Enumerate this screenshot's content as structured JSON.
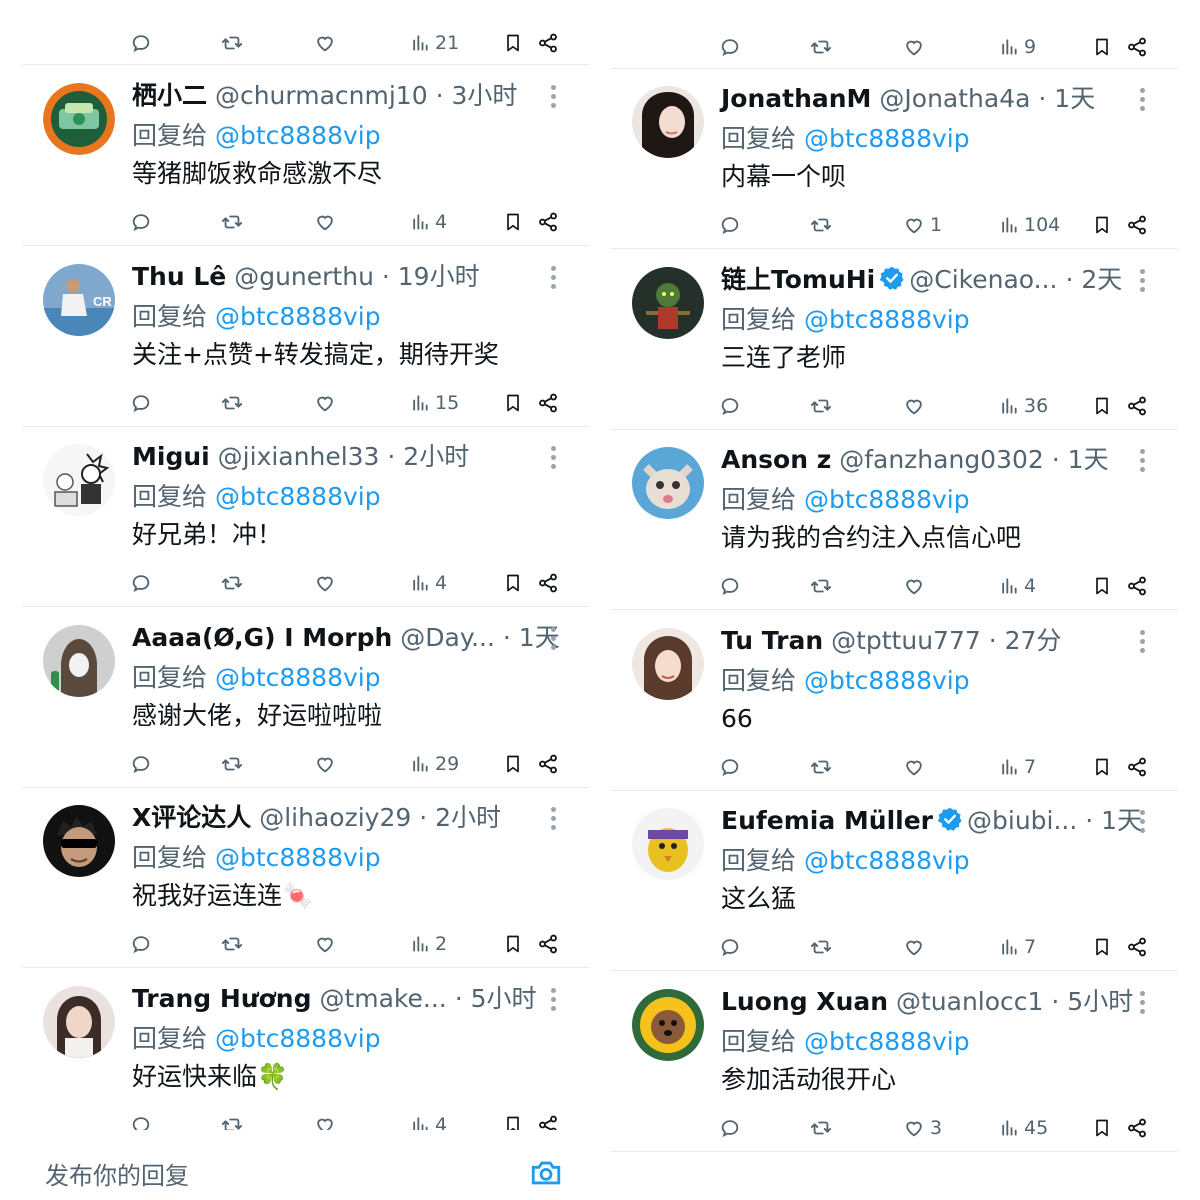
{
  "reply_prefix": "回复给 ",
  "mention": "@btc8888vip",
  "left": {
    "partial_top_views": "21",
    "tweets": [
      {
        "name": "栖小二",
        "handle": "@churmacnmj10",
        "time": "· 3小时",
        "text": "等猪脚饭救命感激不尽",
        "likes": "",
        "views": "4",
        "avatar": "green-badge"
      },
      {
        "name": "Thu Lê",
        "handle": "@gunerthu",
        "time": "· 19小时",
        "text": "关注+点赞+转发搞定，期待开奖",
        "likes": "",
        "views": "15",
        "avatar": "soccer-player"
      },
      {
        "name": "Migui",
        "handle": "@jixianhel33",
        "time": "· 2小时",
        "text": "好兄弟！冲！",
        "likes": "",
        "views": "4",
        "avatar": "manga-sketch"
      },
      {
        "name": "Aaaa(Ø,G) I Morph",
        "handle": "@Day...",
        "time": "· 1天",
        "text": "感谢大佬，好运啦啦啦",
        "likes": "",
        "views": "29",
        "avatar": "hooded-figure"
      },
      {
        "name": "X评论达人",
        "handle": "@lihaoziy29",
        "time": "· 2小时",
        "text": "祝我好运连连🍬",
        "likes": "",
        "views": "2",
        "avatar": "sunglasses-cartoon"
      },
      {
        "name": "Trang Hương",
        "handle": "@tmake...",
        "time": "· 5小时",
        "text": "好运快来临🍀",
        "likes": "",
        "views": "4",
        "avatar": "girl-photo"
      }
    ],
    "compose_placeholder": "发布你的回复"
  },
  "right": {
    "partial_top_views": "9",
    "tweets": [
      {
        "name": "JonathanM",
        "handle": "@Jonatha4a",
        "time": "· 1天",
        "text": "内幕一个呗",
        "likes": "1",
        "views": "104",
        "avatar": "woman-portrait",
        "verified": false
      },
      {
        "name": "链上TomuHi",
        "handle": "@Cikenao...",
        "time": "· 2天",
        "text": "三连了老师",
        "likes": "",
        "views": "36",
        "avatar": "green-goblin",
        "verified": true
      },
      {
        "name": "Anson z",
        "handle": "@fanzhang0302",
        "time": "· 1天",
        "text": "请为我的合约注入点信心吧",
        "likes": "",
        "views": "4",
        "avatar": "cat-photo",
        "verified": false
      },
      {
        "name": "Tu Tran",
        "handle": "@tpttuu777",
        "time": "· 27分",
        "text": "66",
        "likes": "",
        "views": "7",
        "avatar": "girl-photo-2",
        "verified": false
      },
      {
        "name": "Eufemia Müller",
        "handle": "@biubi...",
        "time": "· 1天",
        "text": "这么猛",
        "likes": "",
        "views": "7",
        "avatar": "ninja-bird",
        "verified": true
      },
      {
        "name": "Luong Xuan",
        "handle": "@tuanlocc1",
        "time": "· 5小时",
        "text": "参加活动很开心",
        "likes": "3",
        "views": "45",
        "avatar": "sunflower-dog",
        "verified": false
      }
    ]
  },
  "colors": {
    "accent": "#1d9bf0",
    "text": "#0f1419",
    "muted": "#536471",
    "divider": "#e6ecf0"
  },
  "icons": [
    "reply-icon",
    "retweet-icon",
    "like-icon",
    "views-icon",
    "bookmark-icon",
    "share-icon",
    "more-icon",
    "verified-icon",
    "camera-icon"
  ]
}
